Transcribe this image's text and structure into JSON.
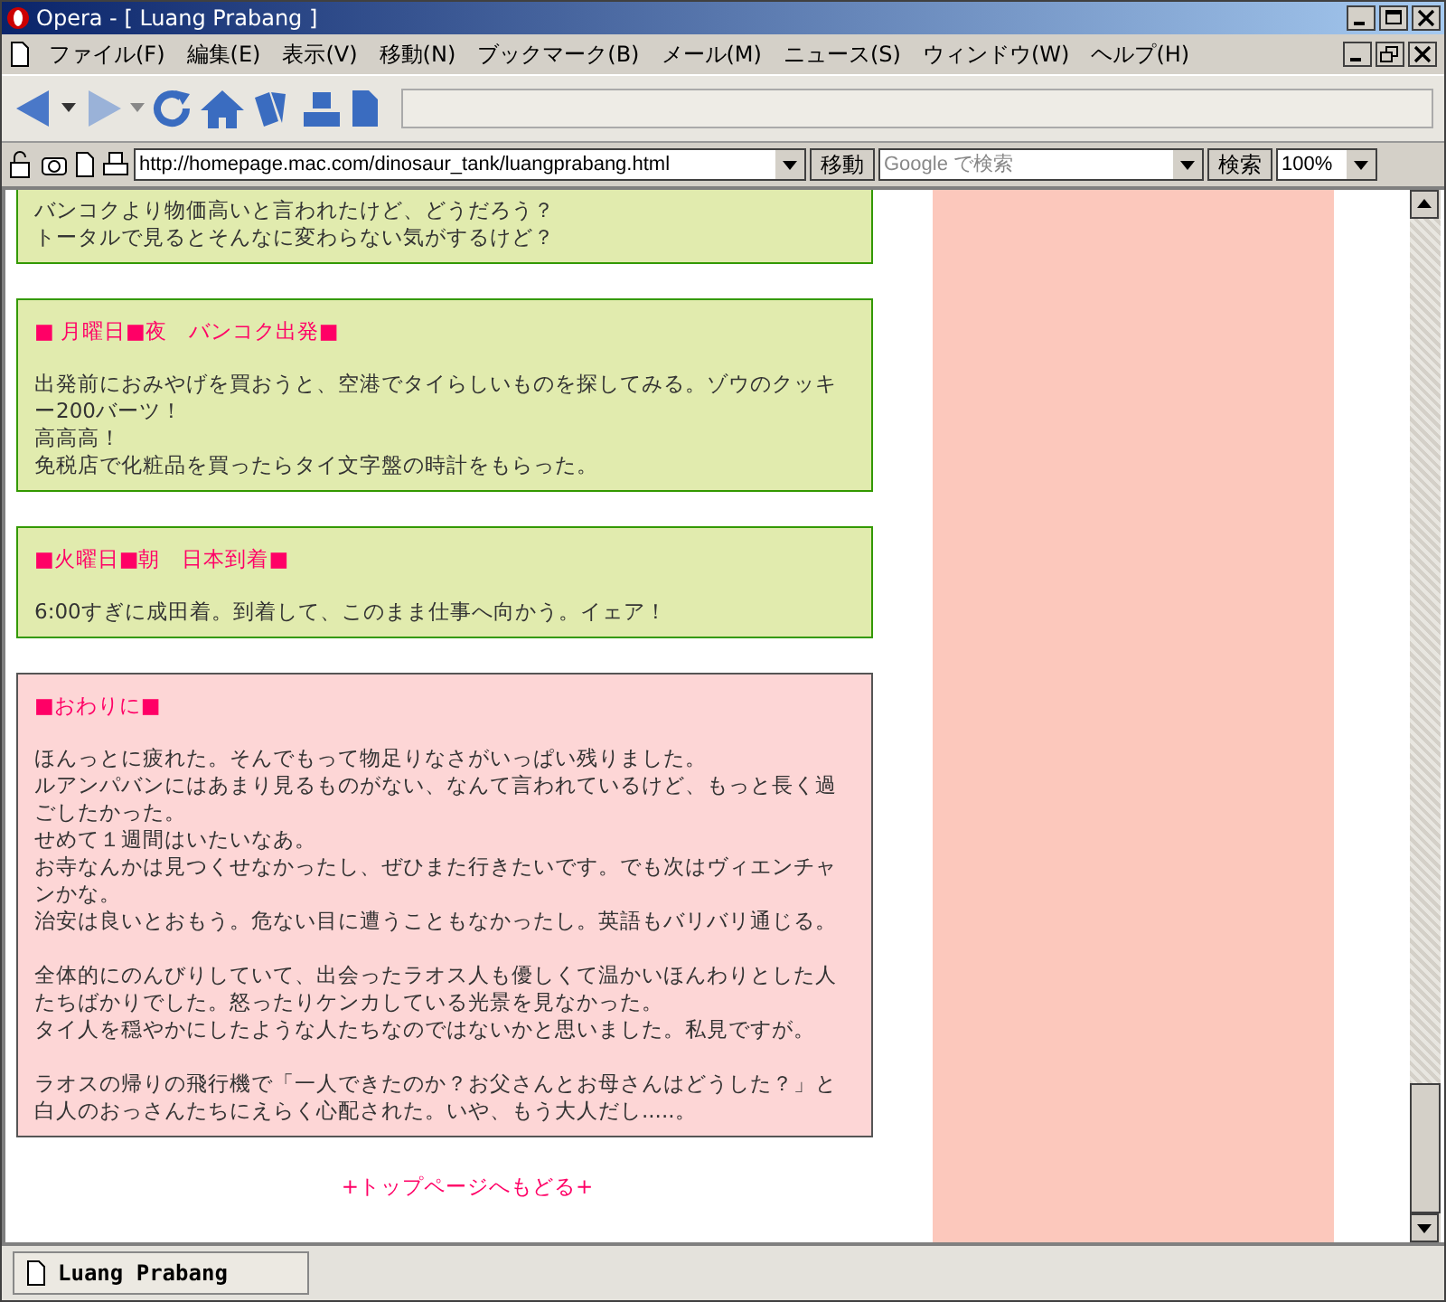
{
  "window": {
    "title": "Opera - [ Luang Prabang ]"
  },
  "menu": [
    "ファイル(F)",
    "編集(E)",
    "表示(V)",
    "移動(N)",
    "ブックマーク(B)",
    "メール(M)",
    "ニュース(S)",
    "ウィンドウ(W)",
    "ヘルプ(H)"
  ],
  "address_bar": {
    "url": "http://homepage.mac.com/dinosaur_tank/luangprabang.html",
    "go_button": "移動",
    "search_placeholder": "Google で検索",
    "search_button": "検索",
    "zoom": "100%"
  },
  "sections": [
    {
      "kind": "green",
      "paragraphs": [
        [
          "バンコクより物価高いと言われたけど、どうだろう？",
          "トータルで見るとそんなに変わらない気がするけど？"
        ]
      ]
    },
    {
      "kind": "green",
      "heading": "■ 月曜日■夜　バンコク出発■",
      "paragraphs": [
        [
          "出発前におみやげを買おうと、空港でタイらしいものを探してみる。ゾウのクッキー200バーツ！",
          "高高高！",
          "免税店で化粧品を買ったらタイ文字盤の時計をもらった。"
        ]
      ]
    },
    {
      "kind": "green",
      "heading": "■火曜日■朝　日本到着■",
      "paragraphs": [
        [
          "6:00すぎに成田着。到着して、このまま仕事へ向かう。イェア！"
        ]
      ]
    },
    {
      "kind": "pink",
      "heading": "■おわりに■",
      "paragraphs": [
        [
          "ほんっとに疲れた。そんでもって物足りなさがいっぱい残りました。",
          "ルアンパバンにはあまり見るものがない、なんて言われているけど、もっと長く過ごしたかった。",
          "せめて１週間はいたいなあ。",
          "お寺なんかは見つくせなかったし、ぜひまた行きたいです。でも次はヴィエンチャンかな。",
          "治安は良いとおもう。危ない目に遭うこともなかったし。英語もバリバリ通じる。"
        ],
        [
          "全体的にのんびりしていて、出会ったラオス人も優しくて温かいほんわりとした人たちばかりでした。怒ったりケンカしている光景を見なかった。",
          "タイ人を穏やかにしたような人たちなのではないかと思いました。私見ですが。"
        ],
        [
          "ラオスの帰りの飛行機で「一人できたのか？お父さんとお母さんはどうした？」と白人のおっさんたちにえらく心配された。いや、もう大人だし.....。"
        ]
      ]
    }
  ],
  "back_link": "+トップページへもどる+",
  "status_tab": "Luang Prabang"
}
